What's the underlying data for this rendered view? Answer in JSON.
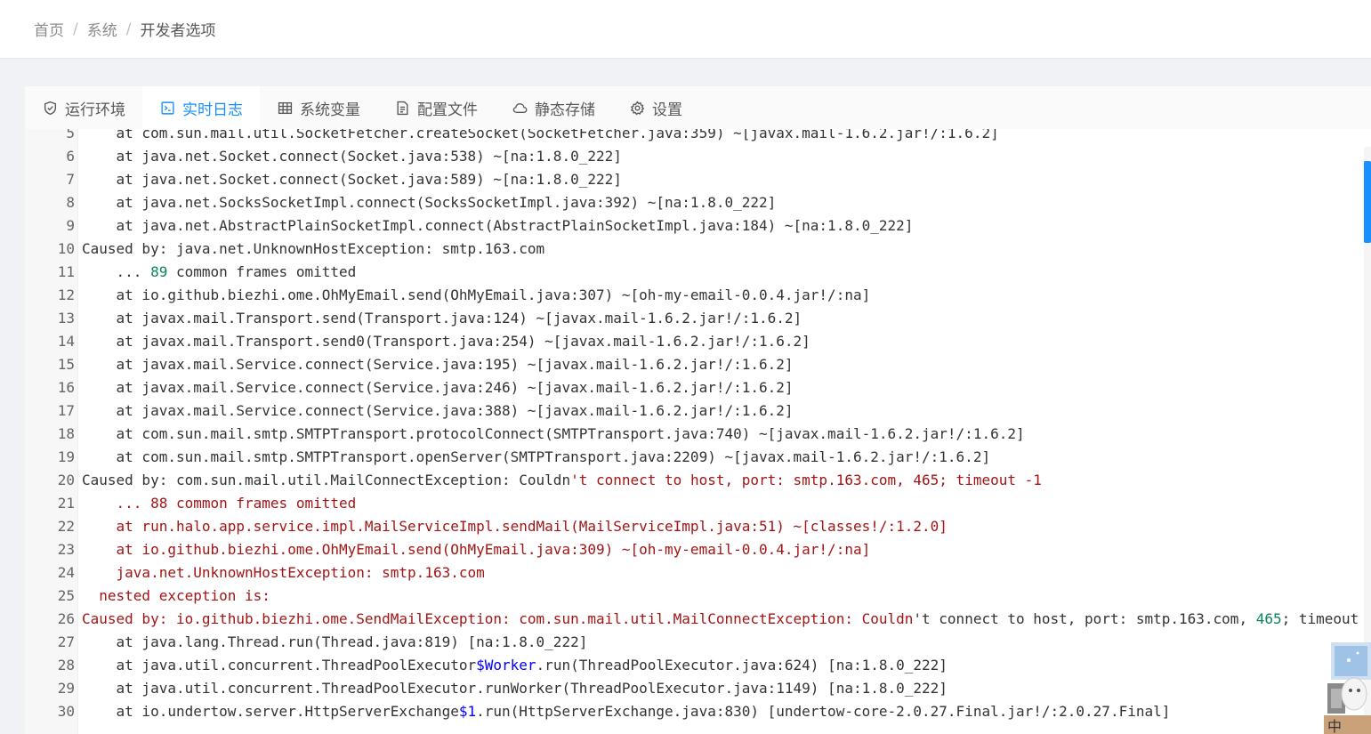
{
  "breadcrumb": {
    "items": [
      "首页",
      "系统",
      "开发者选项"
    ],
    "separator": "/"
  },
  "tabs": [
    {
      "label": "运行环境",
      "icon": "shield-check-icon",
      "active": false
    },
    {
      "label": "实时日志",
      "icon": "terminal-icon",
      "active": true
    },
    {
      "label": "系统变量",
      "icon": "table-icon",
      "active": false
    },
    {
      "label": "配置文件",
      "icon": "file-icon",
      "active": false
    },
    {
      "label": "静态存储",
      "icon": "cloud-icon",
      "active": false
    },
    {
      "label": "设置",
      "icon": "gear-icon",
      "active": false
    }
  ],
  "log": {
    "lines": [
      {
        "no": "5",
        "segments": [
          {
            "t": "    at com.sun.mail.util.SocketFetcher.createSocket(SocketFetcher.java:359) ~[javax.mail-1.6.2.jar!/:1.6.2]"
          }
        ]
      },
      {
        "no": "6",
        "segments": [
          {
            "t": "    at java.net.Socket.connect(Socket.java:538) ~[na:1.8.0_222]"
          }
        ]
      },
      {
        "no": "7",
        "segments": [
          {
            "t": "    at java.net.Socket.connect(Socket.java:589) ~[na:1.8.0_222]"
          }
        ]
      },
      {
        "no": "8",
        "segments": [
          {
            "t": "    at java.net.SocksSocketImpl.connect(SocksSocketImpl.java:392) ~[na:1.8.0_222]"
          }
        ]
      },
      {
        "no": "9",
        "segments": [
          {
            "t": "    at java.net.AbstractPlainSocketImpl.connect(AbstractPlainSocketImpl.java:184) ~[na:1.8.0_222]"
          }
        ]
      },
      {
        "no": "10",
        "segments": [
          {
            "t": "Caused by: java.net.UnknownHostException: smtp.163.com"
          }
        ]
      },
      {
        "no": "11",
        "segments": [
          {
            "t": "    ... "
          },
          {
            "t": "89",
            "c": "n"
          },
          {
            "t": " common frames omitted"
          }
        ]
      },
      {
        "no": "12",
        "segments": [
          {
            "t": "    at io.github.biezhi.ome.OhMyEmail.send(OhMyEmail.java:307) ~[oh-my-email-0.0.4.jar!/:na]"
          }
        ]
      },
      {
        "no": "13",
        "segments": [
          {
            "t": "    at javax.mail.Transport.send(Transport.java:124) ~[javax.mail-1.6.2.jar!/:1.6.2]"
          }
        ]
      },
      {
        "no": "14",
        "segments": [
          {
            "t": "    at javax.mail.Transport.send0(Transport.java:254) ~[javax.mail-1.6.2.jar!/:1.6.2]"
          }
        ]
      },
      {
        "no": "15",
        "segments": [
          {
            "t": "    at javax.mail.Service.connect(Service.java:195) ~[javax.mail-1.6.2.jar!/:1.6.2]"
          }
        ]
      },
      {
        "no": "16",
        "segments": [
          {
            "t": "    at javax.mail.Service.connect(Service.java:246) ~[javax.mail-1.6.2.jar!/:1.6.2]"
          }
        ]
      },
      {
        "no": "17",
        "segments": [
          {
            "t": "    at javax.mail.Service.connect(Service.java:388) ~[javax.mail-1.6.2.jar!/:1.6.2]"
          }
        ]
      },
      {
        "no": "18",
        "segments": [
          {
            "t": "    at com.sun.mail.smtp.SMTPTransport.protocolConnect(SMTPTransport.java:740) ~[javax.mail-1.6.2.jar!/:1.6.2]"
          }
        ]
      },
      {
        "no": "19",
        "segments": [
          {
            "t": "    at com.sun.mail.smtp.SMTPTransport.openServer(SMTPTransport.java:2209) ~[javax.mail-1.6.2.jar!/:1.6.2]"
          }
        ]
      },
      {
        "no": "20",
        "segments": [
          {
            "t": "Caused by: com.sun.mail.util.MailConnectException: Couldn"
          },
          {
            "t": "'t connect to host, port: smtp.163.com, 465; timeout -1",
            "c": "r"
          }
        ]
      },
      {
        "no": "21",
        "segments": [
          {
            "t": "    ... 88 common frames omitted",
            "c": "r"
          }
        ]
      },
      {
        "no": "22",
        "segments": [
          {
            "t": "    at run.halo.app.service.impl.MailServiceImpl.sendMail(MailServiceImpl.java:51) ~[classes!/:1.2.0]",
            "c": "r"
          }
        ]
      },
      {
        "no": "23",
        "segments": [
          {
            "t": "    at io.github.biezhi.ome.OhMyEmail.send(OhMyEmail.java:309) ~[oh-my-email-0.0.4.jar!/:na]",
            "c": "r"
          }
        ]
      },
      {
        "no": "24",
        "segments": [
          {
            "t": "    java.net.UnknownHostException: smtp.163.com",
            "c": "r"
          }
        ]
      },
      {
        "no": "25",
        "segments": [
          {
            "t": "  nested exception is:",
            "c": "r"
          }
        ]
      },
      {
        "no": "26",
        "segments": [
          {
            "t": "Caused by: io.github.biezhi.ome.SendMailException: com.sun.mail.util.MailConnectException: Couldn",
            "c": "r"
          },
          {
            "t": "'t connect to host, port: smtp.163.com, "
          },
          {
            "t": "465",
            "c": "n"
          },
          {
            "t": "; timeout"
          }
        ]
      },
      {
        "no": "27",
        "segments": [
          {
            "t": "    at java.lang.Thread.run(Thread.java:819) [na:1.8.0_222]"
          }
        ]
      },
      {
        "no": "28",
        "segments": [
          {
            "t": "    at java.util.concurrent.ThreadPoolExecutor"
          },
          {
            "t": "$Worker",
            "c": "b"
          },
          {
            "t": ".run(ThreadPoolExecutor.java:624) [na:1.8.0_222]"
          }
        ]
      },
      {
        "no": "29",
        "segments": [
          {
            "t": "    at java.util.concurrent.ThreadPoolExecutor.runWorker(ThreadPoolExecutor.java:1149) [na:1.8.0_222]"
          }
        ]
      },
      {
        "no": "30",
        "segments": [
          {
            "t": "    at io.undertow.server.HttpServerExchange"
          },
          {
            "t": "$1",
            "c": "b"
          },
          {
            "t": ".run(HttpServerExchange.java:830) [undertow-core-2.0.27.Final.jar!/:2.0.27.Final]"
          }
        ]
      }
    ]
  },
  "widget": {
    "label": "中"
  },
  "colors": {
    "accent": "#1890ff",
    "error_text": "#a31515",
    "number_text": "#098658",
    "keyword_text": "#0000ff"
  }
}
